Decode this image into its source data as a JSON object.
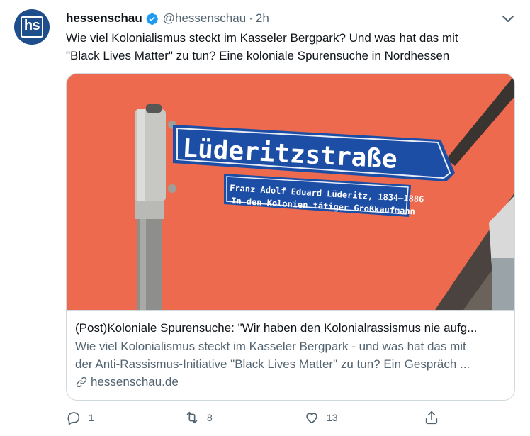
{
  "author": {
    "avatar_text": "hs",
    "name": "hessenschau",
    "handle": "@hessenschau",
    "separator": "·",
    "time": "2h"
  },
  "tweet": {
    "text_line1": "Wie viel Kolonialismus steckt im Kasseler Bergpark? Und was hat das mit",
    "text_line2": "\"Black Lives Matter\" zu tun? Eine koloniale Spurensuche in Nordhessen"
  },
  "card": {
    "sign_main": "Lüderitzstraße",
    "sign_sub1": "Franz Adolf Eduard Lüderitz, 1834–1886",
    "sign_sub2": "In den Kolonien tätiger Großkaufmann",
    "title": "(Post)Koloniale Spurensuche: \"Wir haben den Kolonialrassismus nie aufg...",
    "desc_line1": "Wie viel Kolonialismus steckt im Kasseler Bergpark - und was hat das mit",
    "desc_line2": "der Anti-Rassismus-Initiative \"Black Lives Matter\" zu tun? Ein Gespräch ...",
    "domain": "hessenschau.de"
  },
  "actions": {
    "reply_count": "1",
    "retweet_count": "8",
    "like_count": "13"
  },
  "colors": {
    "verified": "#1d9bf0",
    "brand": "#1f4e8c",
    "background_orange": "#ee6a4f",
    "sign_blue": "#1d4ea6"
  },
  "icons": [
    "verified-icon",
    "chevron-down-icon",
    "link-icon",
    "reply-icon",
    "retweet-icon",
    "like-icon",
    "share-icon"
  ]
}
